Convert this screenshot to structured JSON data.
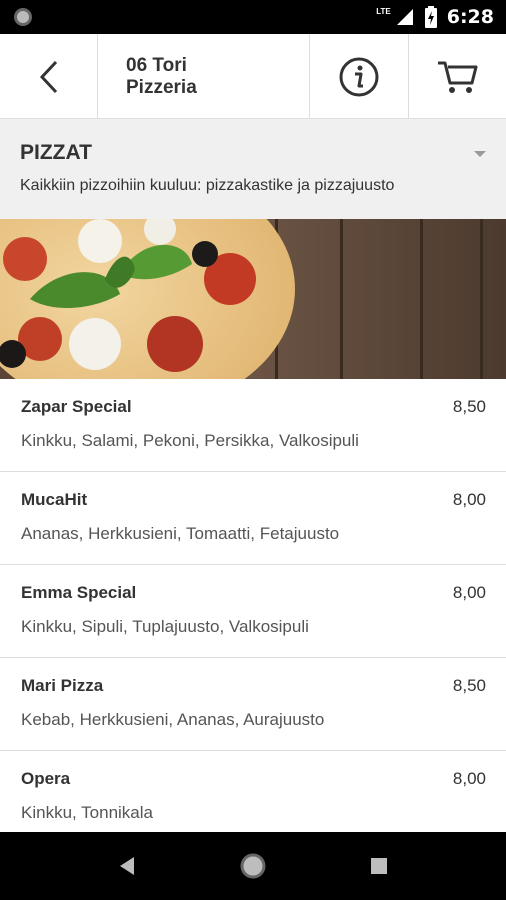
{
  "status_bar": {
    "network_label": "LTE",
    "time": "6:28"
  },
  "header": {
    "title": "06 Tori\nPizzeria"
  },
  "category": {
    "name": "PIZZAT",
    "description": "Kaikkiin pizzoihiin kuuluu: pizzakastike ja pizzajuusto"
  },
  "menu_items": [
    {
      "name": "Zapar Special",
      "price": "8,50",
      "ingredients": "Kinkku, Salami, Pekoni, Persikka, Valkosipuli"
    },
    {
      "name": "MucaHit",
      "price": "8,00",
      "ingredients": "Ananas, Herkkusieni, Tomaatti, Fetajuusto"
    },
    {
      "name": "Emma Special",
      "price": "8,00",
      "ingredients": "Kinkku, Sipuli, Tuplajuusto, Valkosipuli"
    },
    {
      "name": "Mari Pizza",
      "price": "8,50",
      "ingredients": "Kebab, Herkkusieni, Ananas, Aurajuusto"
    },
    {
      "name": "Opera",
      "price": "8,00",
      "ingredients": "Kinkku, Tonnikala"
    }
  ],
  "icons": {
    "back": "back-arrow-icon",
    "info": "info-icon",
    "cart": "cart-icon",
    "dropdown": "chevron-down-icon"
  },
  "colors": {
    "header_bg": "#ffffff",
    "category_bg": "#f0f0f0",
    "text": "#333333",
    "system_bars": "#000000"
  }
}
